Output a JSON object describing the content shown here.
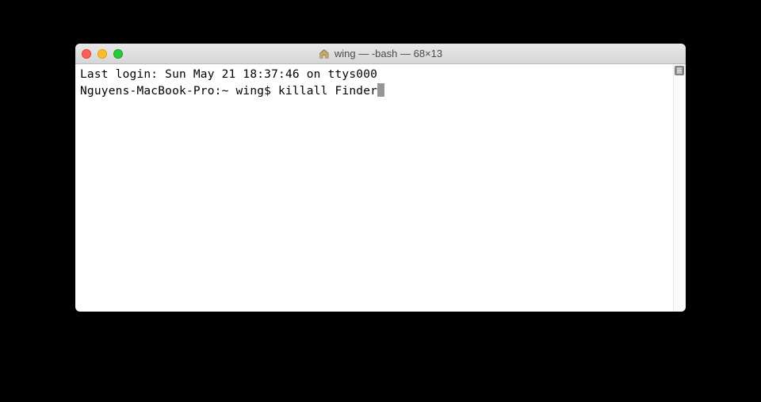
{
  "window": {
    "title": "wing — -bash — 68×13"
  },
  "terminal": {
    "login_line": "Last login: Sun May 21 18:37:46 on ttys000",
    "prompt": "Nguyens-MacBook-Pro:~ wing$ ",
    "command": "killall Finder"
  }
}
